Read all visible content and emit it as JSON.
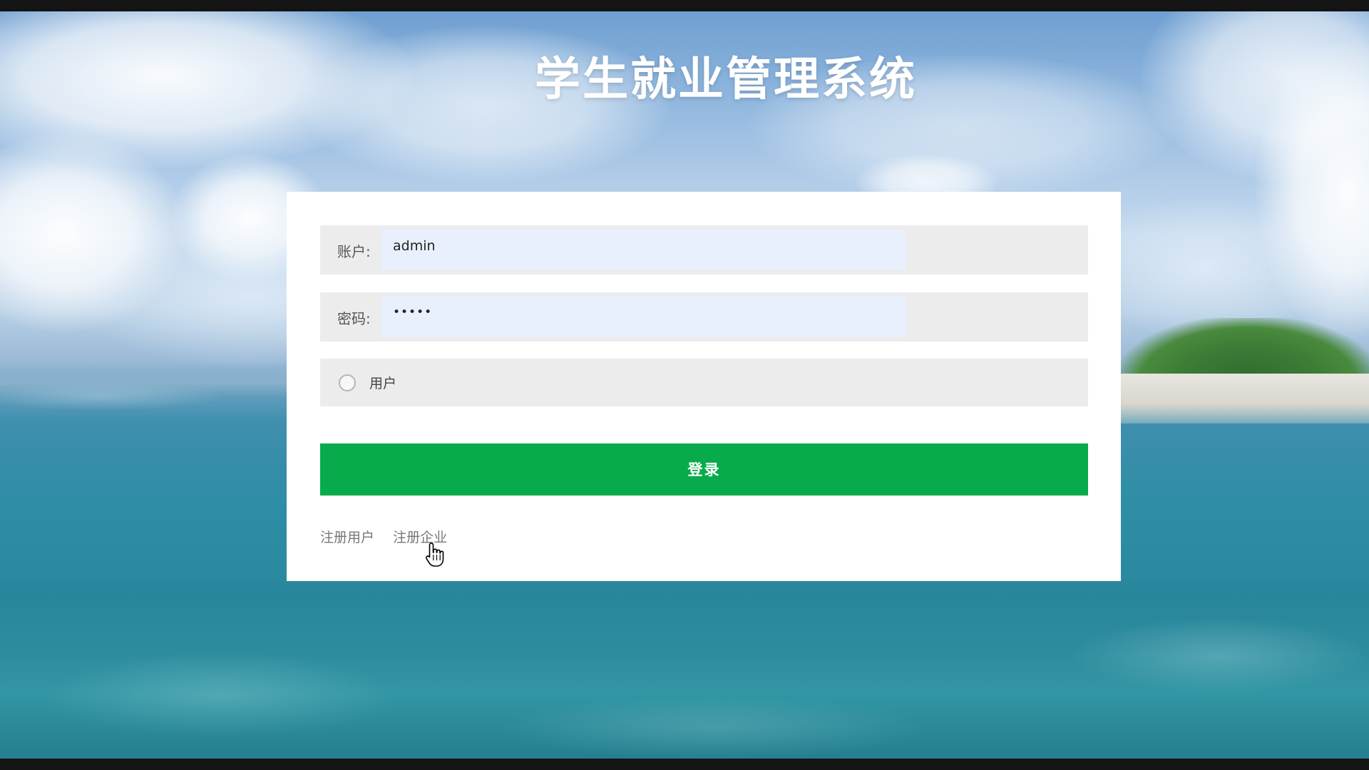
{
  "page": {
    "title": "学生就业管理系统"
  },
  "login_form": {
    "account_label": "账户:",
    "account_value": "admin",
    "password_label": "密码:",
    "password_value": "•••••",
    "role_option": "用户",
    "login_button": "登录"
  },
  "register": {
    "links": [
      "注册用户",
      "注册企业"
    ]
  },
  "colors": {
    "primary_button": "#07ab4b",
    "input_autofill_bg": "#e8f0fe",
    "field_row_bg": "#ececec"
  },
  "icons": {
    "radio": "radio-unchecked-icon",
    "cursor": "hand-pointer-icon"
  }
}
